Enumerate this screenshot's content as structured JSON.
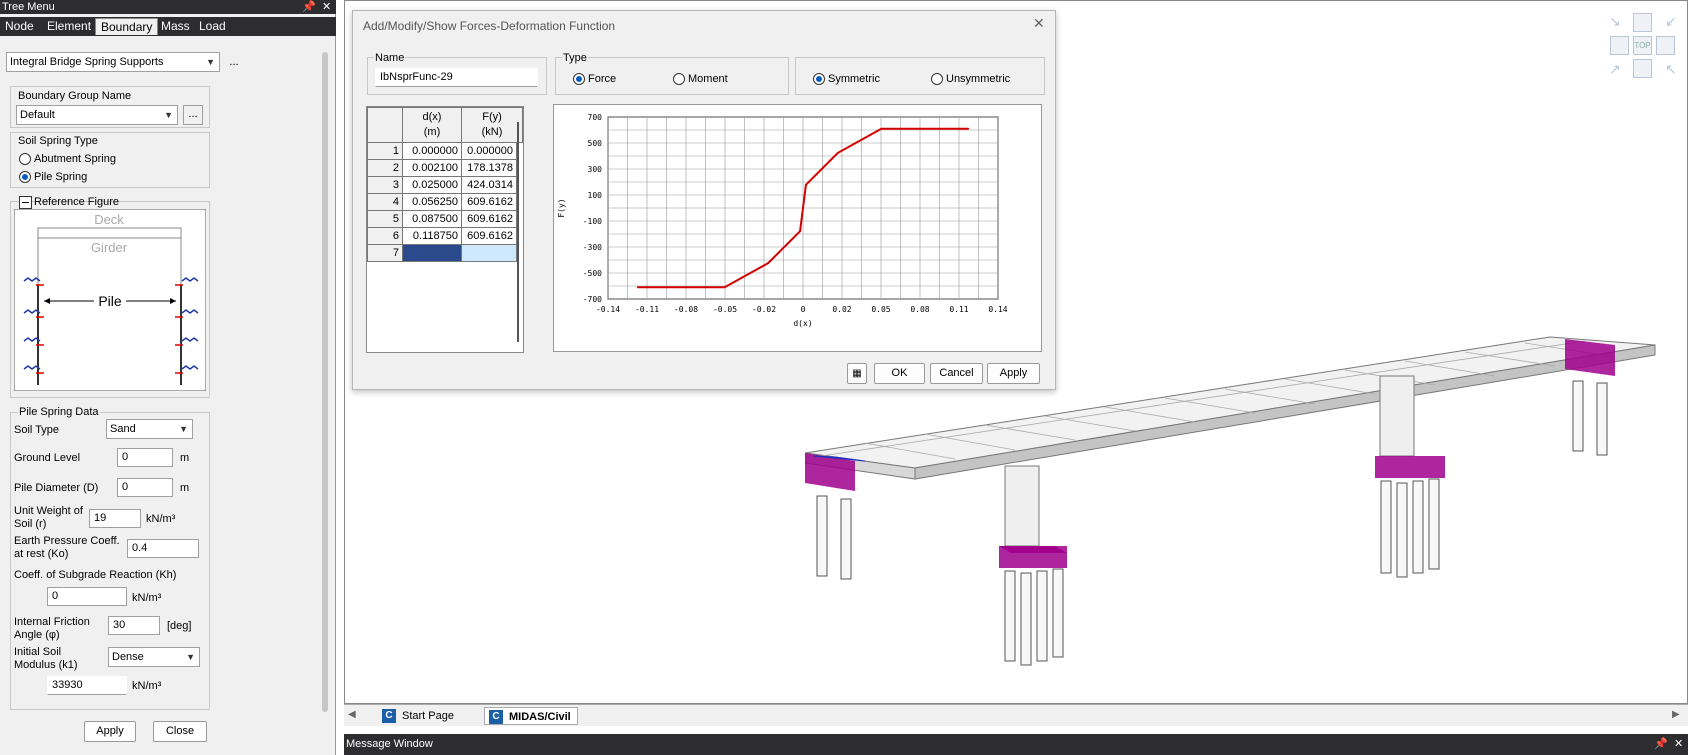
{
  "tree_menu": {
    "title": "Tree Menu",
    "tabs": [
      "Node",
      "Element",
      "Boundary",
      "Mass",
      "Load"
    ],
    "active_tab": "Boundary",
    "function_combo": "Integral Bridge Spring Supports",
    "more_label": "...",
    "boundary_group_label": "Boundary Group Name",
    "boundary_group_value": "Default",
    "soil_spring_type_label": "Soil Spring Type",
    "abutment_spring": "Abutment Spring",
    "pile_spring": "Pile Spring",
    "reference_figure_label": "Reference Figure",
    "figure": {
      "deck": "Deck",
      "girder": "Girder",
      "pile": "Pile"
    },
    "pile_spring_data_label": "Pile Spring Data",
    "soil_type_label": "Soil Type",
    "soil_type_value": "Sand",
    "ground_level_label": "Ground Level",
    "ground_level_value": "0",
    "unit_m": "m",
    "pile_diameter_label": "Pile Diameter (D)",
    "pile_diameter_value": "0",
    "unit_weight_label1": "Unit Weight of",
    "unit_weight_label2": "Soil (r)",
    "unit_weight_value": "19",
    "unit_knm3": "kN/m³",
    "earth_pressure_label1": "Earth Pressure Coeff.",
    "earth_pressure_label2": "at rest (Ko)",
    "earth_pressure_value": "0.4",
    "subgrade_label": "Coeff. of Subgrade Reaction (Kh)",
    "subgrade_value": "0",
    "friction_label1": "Internal Friction",
    "friction_label2": "Angle (φ)",
    "friction_value": "30",
    "deg_unit": "[deg]",
    "soil_modulus_label1": "Initial Soil",
    "soil_modulus_label2": "Modulus (k1)",
    "soil_modulus_combo": "Dense",
    "soil_modulus_value": "33930",
    "apply": "Apply",
    "close": "Close"
  },
  "dialog": {
    "title": "Add/Modify/Show Forces-Deformation Function",
    "name_label": "Name",
    "name_value": "IbNsprFunc-29",
    "type_label": "Type",
    "force": "Force",
    "moment": "Moment",
    "symmetric": "Symmetric",
    "unsymmetric": "Unsymmetric",
    "col_d": "d(x)",
    "col_d_unit": "(m)",
    "col_f": "F(y)",
    "col_f_unit": "(kN)",
    "rows": [
      {
        "n": "1",
        "d": "0.000000",
        "f": "0.000000"
      },
      {
        "n": "2",
        "d": "0.002100",
        "f": "178.1378"
      },
      {
        "n": "3",
        "d": "0.025000",
        "f": "424.0314"
      },
      {
        "n": "4",
        "d": "0.056250",
        "f": "609.6162"
      },
      {
        "n": "5",
        "d": "0.087500",
        "f": "609.6162"
      },
      {
        "n": "6",
        "d": "0.118750",
        "f": "609.6162"
      },
      {
        "n": "7",
        "d": "",
        "f": ""
      }
    ],
    "ok": "OK",
    "cancel": "Cancel",
    "apply": "Apply"
  },
  "chart_data": {
    "type": "line",
    "xlabel": "d(x)",
    "ylabel": "F(y)",
    "xlim": [
      -0.14,
      0.14
    ],
    "ylim": [
      -700,
      700
    ],
    "xticks": [
      "-0.14",
      "-0.11",
      "-0.08",
      "-0.05",
      "-0.02",
      "0",
      "0.02",
      "0.05",
      "0.08",
      "0.11",
      "0.14"
    ],
    "yticks": [
      "700",
      "500",
      "300",
      "100",
      "-100",
      "-300",
      "-500",
      "-700"
    ],
    "color": "#d40000",
    "x": [
      -0.11875,
      -0.0875,
      -0.05625,
      -0.025,
      -0.0021,
      0,
      0.0021,
      0.025,
      0.05625,
      0.0875,
      0.11875
    ],
    "y": [
      -609.6162,
      -609.6162,
      -609.6162,
      -424.0314,
      -178.1378,
      0,
      178.1378,
      424.0314,
      609.6162,
      609.6162,
      609.6162
    ]
  },
  "doc_tabs": [
    "Start Page",
    "MIDAS/Civil"
  ],
  "active_doc_tab": "MIDAS/Civil",
  "message_window": "Message Window",
  "view_cube_label": "TOP"
}
